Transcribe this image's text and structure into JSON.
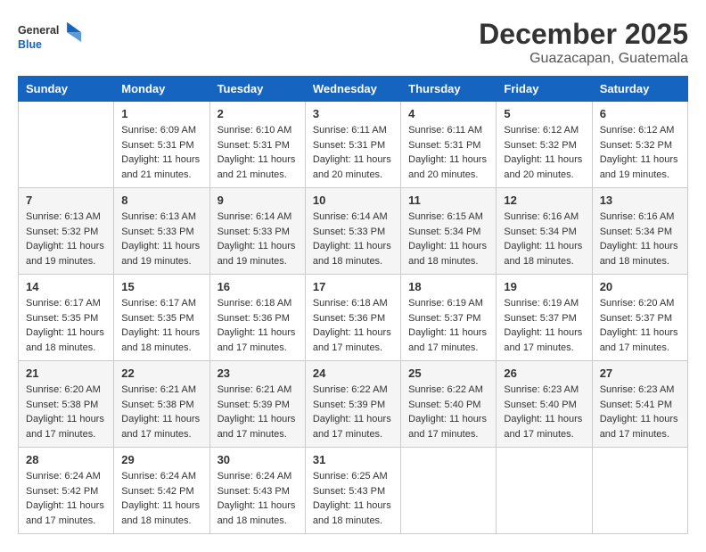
{
  "logo": {
    "general": "General",
    "blue": "Blue"
  },
  "title": {
    "month": "December 2025",
    "location": "Guazacapan, Guatemala"
  },
  "headers": [
    "Sunday",
    "Monday",
    "Tuesday",
    "Wednesday",
    "Thursday",
    "Friday",
    "Saturday"
  ],
  "weeks": [
    [
      {
        "day": "",
        "info": ""
      },
      {
        "day": "1",
        "info": "Sunrise: 6:09 AM\nSunset: 5:31 PM\nDaylight: 11 hours\nand 21 minutes."
      },
      {
        "day": "2",
        "info": "Sunrise: 6:10 AM\nSunset: 5:31 PM\nDaylight: 11 hours\nand 21 minutes."
      },
      {
        "day": "3",
        "info": "Sunrise: 6:11 AM\nSunset: 5:31 PM\nDaylight: 11 hours\nand 20 minutes."
      },
      {
        "day": "4",
        "info": "Sunrise: 6:11 AM\nSunset: 5:31 PM\nDaylight: 11 hours\nand 20 minutes."
      },
      {
        "day": "5",
        "info": "Sunrise: 6:12 AM\nSunset: 5:32 PM\nDaylight: 11 hours\nand 20 minutes."
      },
      {
        "day": "6",
        "info": "Sunrise: 6:12 AM\nSunset: 5:32 PM\nDaylight: 11 hours\nand 19 minutes."
      }
    ],
    [
      {
        "day": "7",
        "info": "Sunrise: 6:13 AM\nSunset: 5:32 PM\nDaylight: 11 hours\nand 19 minutes."
      },
      {
        "day": "8",
        "info": "Sunrise: 6:13 AM\nSunset: 5:33 PM\nDaylight: 11 hours\nand 19 minutes."
      },
      {
        "day": "9",
        "info": "Sunrise: 6:14 AM\nSunset: 5:33 PM\nDaylight: 11 hours\nand 19 minutes."
      },
      {
        "day": "10",
        "info": "Sunrise: 6:14 AM\nSunset: 5:33 PM\nDaylight: 11 hours\nand 18 minutes."
      },
      {
        "day": "11",
        "info": "Sunrise: 6:15 AM\nSunset: 5:34 PM\nDaylight: 11 hours\nand 18 minutes."
      },
      {
        "day": "12",
        "info": "Sunrise: 6:16 AM\nSunset: 5:34 PM\nDaylight: 11 hours\nand 18 minutes."
      },
      {
        "day": "13",
        "info": "Sunrise: 6:16 AM\nSunset: 5:34 PM\nDaylight: 11 hours\nand 18 minutes."
      }
    ],
    [
      {
        "day": "14",
        "info": "Sunrise: 6:17 AM\nSunset: 5:35 PM\nDaylight: 11 hours\nand 18 minutes."
      },
      {
        "day": "15",
        "info": "Sunrise: 6:17 AM\nSunset: 5:35 PM\nDaylight: 11 hours\nand 18 minutes."
      },
      {
        "day": "16",
        "info": "Sunrise: 6:18 AM\nSunset: 5:36 PM\nDaylight: 11 hours\nand 17 minutes."
      },
      {
        "day": "17",
        "info": "Sunrise: 6:18 AM\nSunset: 5:36 PM\nDaylight: 11 hours\nand 17 minutes."
      },
      {
        "day": "18",
        "info": "Sunrise: 6:19 AM\nSunset: 5:37 PM\nDaylight: 11 hours\nand 17 minutes."
      },
      {
        "day": "19",
        "info": "Sunrise: 6:19 AM\nSunset: 5:37 PM\nDaylight: 11 hours\nand 17 minutes."
      },
      {
        "day": "20",
        "info": "Sunrise: 6:20 AM\nSunset: 5:37 PM\nDaylight: 11 hours\nand 17 minutes."
      }
    ],
    [
      {
        "day": "21",
        "info": "Sunrise: 6:20 AM\nSunset: 5:38 PM\nDaylight: 11 hours\nand 17 minutes."
      },
      {
        "day": "22",
        "info": "Sunrise: 6:21 AM\nSunset: 5:38 PM\nDaylight: 11 hours\nand 17 minutes."
      },
      {
        "day": "23",
        "info": "Sunrise: 6:21 AM\nSunset: 5:39 PM\nDaylight: 11 hours\nand 17 minutes."
      },
      {
        "day": "24",
        "info": "Sunrise: 6:22 AM\nSunset: 5:39 PM\nDaylight: 11 hours\nand 17 minutes."
      },
      {
        "day": "25",
        "info": "Sunrise: 6:22 AM\nSunset: 5:40 PM\nDaylight: 11 hours\nand 17 minutes."
      },
      {
        "day": "26",
        "info": "Sunrise: 6:23 AM\nSunset: 5:40 PM\nDaylight: 11 hours\nand 17 minutes."
      },
      {
        "day": "27",
        "info": "Sunrise: 6:23 AM\nSunset: 5:41 PM\nDaylight: 11 hours\nand 17 minutes."
      }
    ],
    [
      {
        "day": "28",
        "info": "Sunrise: 6:24 AM\nSunset: 5:42 PM\nDaylight: 11 hours\nand 17 minutes."
      },
      {
        "day": "29",
        "info": "Sunrise: 6:24 AM\nSunset: 5:42 PM\nDaylight: 11 hours\nand 18 minutes."
      },
      {
        "day": "30",
        "info": "Sunrise: 6:24 AM\nSunset: 5:43 PM\nDaylight: 11 hours\nand 18 minutes."
      },
      {
        "day": "31",
        "info": "Sunrise: 6:25 AM\nSunset: 5:43 PM\nDaylight: 11 hours\nand 18 minutes."
      },
      {
        "day": "",
        "info": ""
      },
      {
        "day": "",
        "info": ""
      },
      {
        "day": "",
        "info": ""
      }
    ]
  ]
}
